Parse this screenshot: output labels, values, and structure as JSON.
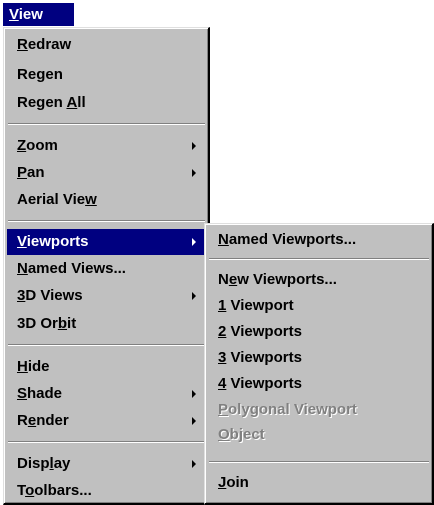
{
  "menubar": {
    "title_mnemonic": "V",
    "title_rest": "iew"
  },
  "main_menu": {
    "redraw": {
      "pre": "",
      "mn": "R",
      "post": "edraw"
    },
    "regen": {
      "pre": "Re",
      "mn": "g",
      "post": "en"
    },
    "regen_all": {
      "pre": "Regen ",
      "mn": "A",
      "post": "ll"
    },
    "zoom": {
      "pre": "",
      "mn": "Z",
      "post": "oom"
    },
    "pan": {
      "pre": "",
      "mn": "P",
      "post": "an"
    },
    "aerial_view": {
      "pre": "Aerial Vie",
      "mn": "w",
      "post": ""
    },
    "viewports": {
      "pre": "",
      "mn": "V",
      "post": "iewports"
    },
    "named_views": {
      "pre": "",
      "mn": "N",
      "post": "amed Views..."
    },
    "views_3d": {
      "pre": "",
      "mn": "3",
      "post": "D Views"
    },
    "orbit_3d": {
      "pre": "3D Or",
      "mn": "b",
      "post": "it"
    },
    "hide": {
      "pre": "",
      "mn": "H",
      "post": "ide"
    },
    "shade": {
      "pre": "",
      "mn": "S",
      "post": "hade"
    },
    "render": {
      "pre": "R",
      "mn": "e",
      "post": "nder"
    },
    "display": {
      "pre": "Disp",
      "mn": "l",
      "post": "ay"
    },
    "toolbars": {
      "pre": "T",
      "mn": "o",
      "post": "olbars..."
    }
  },
  "viewports_submenu": {
    "named_viewports": {
      "pre": "",
      "mn": "N",
      "post": "amed Viewports..."
    },
    "new_viewports": {
      "pre": "N",
      "mn": "e",
      "post": "w Viewports..."
    },
    "one_viewport": {
      "pre": "",
      "mn": "1",
      "post": " Viewport"
    },
    "two_viewports": {
      "pre": "",
      "mn": "2",
      "post": " Viewports"
    },
    "three_viewports": {
      "pre": "",
      "mn": "3",
      "post": " Viewports"
    },
    "four_viewports": {
      "pre": "",
      "mn": "4",
      "post": " Viewports"
    },
    "polygonal_viewport": {
      "pre": "",
      "mn": "P",
      "post": "olygonal Viewport"
    },
    "object": {
      "pre": "",
      "mn": "O",
      "post": "bject"
    },
    "join": {
      "pre": "",
      "mn": "J",
      "post": "oin"
    }
  },
  "colors": {
    "menu_face": "#c0c0c0",
    "highlight": "#000080",
    "disabled_text": "#808080"
  }
}
